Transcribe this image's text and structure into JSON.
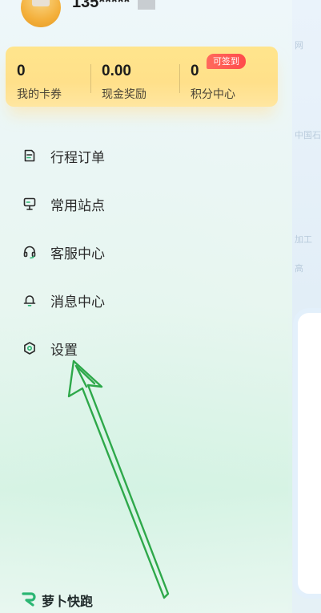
{
  "user": {
    "phone_masked": "135*****"
  },
  "stats": [
    {
      "value": "0",
      "label": "我的卡券"
    },
    {
      "value": "0.00",
      "label": "现金奖励"
    },
    {
      "value": "0",
      "label": "积分中心"
    }
  ],
  "signin_badge": "可签到",
  "menu": [
    {
      "label": "行程订单",
      "icon": "order-list-icon"
    },
    {
      "label": "常用站点",
      "icon": "station-pin-icon"
    },
    {
      "label": "客服中心",
      "icon": "headset-icon"
    },
    {
      "label": "消息中心",
      "icon": "bell-icon"
    },
    {
      "label": "设置",
      "icon": "gear-icon"
    }
  ],
  "brand": {
    "name": "萝卜快跑"
  },
  "colors": {
    "accent_green": "#2bb673",
    "stats_card_yellow": "#ffe08a",
    "badge_red": "#ff4b4b",
    "annotation_arrow": "#2ea84a"
  },
  "backdrop_fragments": [
    "网",
    "中国石",
    "加工",
    "高"
  ]
}
